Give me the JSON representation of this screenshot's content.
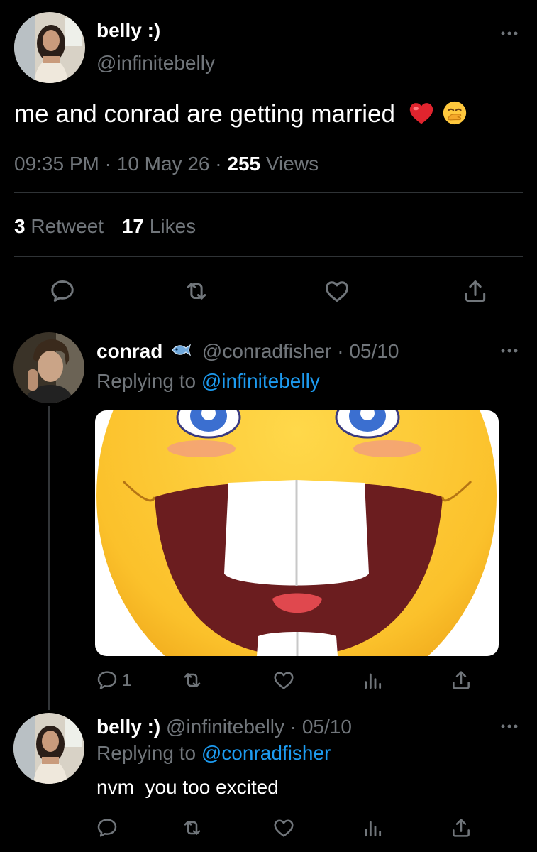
{
  "main_tweet": {
    "author_name": "belly :)",
    "author_handle": "@infinitebelly",
    "text": "me and conrad are getting married",
    "emojis": [
      "red-heart",
      "face-with-hand-over-mouth"
    ],
    "time": "09:35 PM",
    "date": "10 May 26",
    "views_count": "255",
    "views_label": "Views",
    "retweet_count": "3",
    "retweet_label": "Retweet",
    "likes_count": "17",
    "likes_label": "Likes"
  },
  "reply1": {
    "author_name": "conrad",
    "name_emoji": "fish",
    "author_handle": "@conradfisher",
    "date": "· 05/10",
    "replying_prefix": "Replying to",
    "replying_handle": "@infinitebelly",
    "reply_count": "1",
    "media": "laughing-emoji-closeup"
  },
  "reply2": {
    "author_name": "belly :)",
    "author_handle": "@infinitebelly",
    "date": "· 05/10",
    "replying_prefix": "Replying to",
    "replying_handle": "@conradfisher",
    "text": "nvm  you too excited"
  },
  "colors": {
    "background": "#000000",
    "muted": "#71767b",
    "link": "#1d9bf0",
    "divider": "#2f3336",
    "heart": "#e0242e"
  }
}
